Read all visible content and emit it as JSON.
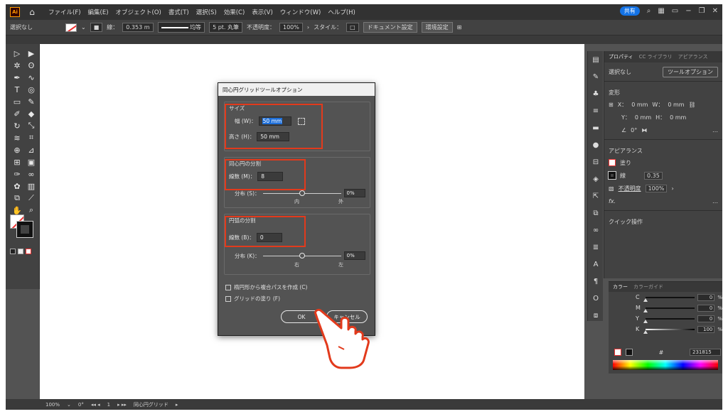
{
  "menubar": {
    "logo": "Ai",
    "items": [
      "ファイル(F)",
      "編集(E)",
      "オブジェクト(O)",
      "書式(T)",
      "選択(S)",
      "効果(C)",
      "表示(V)",
      "ウィンドウ(W)",
      "ヘルプ(H)"
    ],
    "share": "共有"
  },
  "controlbar": {
    "selection": "選択なし",
    "stroke_label": "線：",
    "stroke_weight": "0.353 m",
    "stroke_style": "均等",
    "brush": "5 pt. 丸筆",
    "opacity_label": "不透明度：",
    "opacity": "100%",
    "style_label": "スタイル：",
    "doc_settings": "ドキュメント設定",
    "prefs": "環境設定"
  },
  "properties": {
    "tabs": [
      "プロパティ",
      "CC ライブラリ",
      "アピアランス"
    ],
    "no_selection": "選択なし",
    "tool_options": "ツールオプション",
    "transform": "変形",
    "x_label": "X：",
    "y_label": "Y：",
    "w_label": "W：",
    "h_label": "H：",
    "x_value": "0 mm",
    "y_value": "0 mm",
    "w_value": "0 mm",
    "h_value": "0 mm",
    "angle_value": "0°",
    "appearance": "アピアランス",
    "fill": "塗り",
    "stroke": "線",
    "stroke_weight": "0.35",
    "opacity_label": "不透明度",
    "opacity": "100%",
    "fx": "fx.",
    "quick_actions": "クイック操作"
  },
  "color": {
    "tabs": [
      "カラー",
      "カラーガイド"
    ],
    "channels": [
      {
        "label": "C",
        "value": "0",
        "unit": "%"
      },
      {
        "label": "M",
        "value": "0",
        "unit": "%"
      },
      {
        "label": "Y",
        "value": "0",
        "unit": "%"
      },
      {
        "label": "K",
        "value": "100",
        "unit": "%"
      }
    ],
    "hex_prefix": "#",
    "hex": "231815"
  },
  "statusbar": {
    "zoom": "100%",
    "angle": "0°",
    "artboard": "1",
    "tool": "同心円グリッド"
  },
  "dialog": {
    "title": "同心円グリッドツールオプション",
    "size_title": "サイズ",
    "width_label": "幅 (W)：",
    "width_value": "50 mm",
    "height_label": "高さ (H)：",
    "height_value": "50 mm",
    "concentric_title": "同心円の分割",
    "concentric_count_label": "線数 (M)：",
    "concentric_count": "8",
    "skew1_label": "分布 (S)：",
    "skew1_value": "0%",
    "skew1_left": "内",
    "skew1_right": "外",
    "radial_title": "円弧の分割",
    "radial_count_label": "線数 (B)：",
    "radial_count": "0",
    "skew2_label": "分布 (K)：",
    "skew2_value": "0%",
    "skew2_left": "右",
    "skew2_right": "左",
    "check1": "楕円形から複合パスを作成 (C)",
    "check2": "グリッドの塗り (F)",
    "ok": "OK",
    "cancel": "キャンセル"
  }
}
